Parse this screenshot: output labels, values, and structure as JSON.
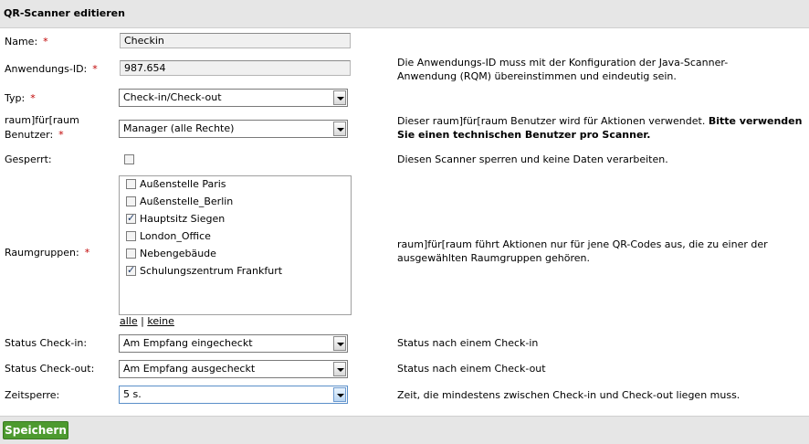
{
  "header": {
    "title": "QR-Scanner editieren"
  },
  "form": {
    "name": {
      "label": "Name:",
      "required": "*",
      "value": "Checkin"
    },
    "app_id": {
      "label": "Anwendungs-ID:",
      "required": "*",
      "value": "987.654",
      "help": "Die Anwendungs-ID muss mit der Konfiguration der Java-Scanner-Anwendung (RQM) übereinstimmen und eindeutig sein."
    },
    "type": {
      "label": "Typ:",
      "required": "*",
      "value": "Check-in/Check-out"
    },
    "user": {
      "label_line1": "raum]für[raum",
      "label_line2": "Benutzer:",
      "required": "*",
      "value": "Manager (alle Rechte)",
      "help_plain": "Dieser raum]für[raum Benutzer wird für Aktionen verwendet. ",
      "help_bold": "Bitte verwenden Sie einen technischen Benutzer pro Scanner."
    },
    "locked": {
      "label": "Gesperrt:",
      "checked": false,
      "help": "Diesen Scanner sperren und keine Daten verarbeiten."
    },
    "roomgroups": {
      "label": "Raumgruppen:",
      "required": "*",
      "items": [
        {
          "label": "Außenstelle Paris",
          "checked": false
        },
        {
          "label": "Außenstelle_Berlin",
          "checked": false
        },
        {
          "label": "Hauptsitz Siegen",
          "checked": true
        },
        {
          "label": "London_Office",
          "checked": false
        },
        {
          "label": "Nebengebäude",
          "checked": false
        },
        {
          "label": "Schulungszentrum Frankfurt",
          "checked": true
        }
      ],
      "all_link": "alle",
      "separator": "|",
      "none_link": "keine",
      "help": "raum]für[raum führt Aktionen nur für jene QR-Codes aus, die zu einer der ausgewählten Raumgruppen gehören."
    },
    "status_checkin": {
      "label": "Status Check-in:",
      "value": "Am Empfang eingecheckt",
      "help": "Status nach einem Check-in"
    },
    "status_checkout": {
      "label": "Status Check-out:",
      "value": "Am Empfang ausgecheckt",
      "help": "Status nach einem Check-out"
    },
    "timeout": {
      "label": "Zeitsperre:",
      "value": "5 s.",
      "help": "Zeit, die mindestens zwischen Check-in und Check-out liegen muss."
    }
  },
  "footer": {
    "save_label": "Speichern"
  }
}
